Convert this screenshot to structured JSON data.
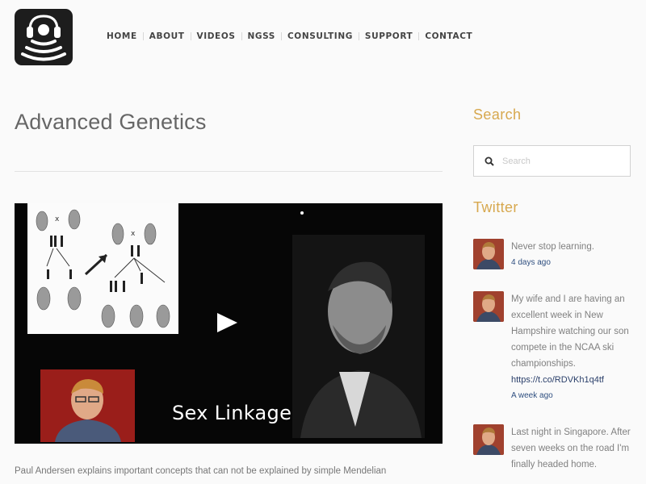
{
  "header": {
    "logo_icon": "headphones-signal-icon",
    "nav": [
      "HOME",
      "ABOUT",
      "VIDEOS",
      "NGSS",
      "CONSULTING",
      "SUPPORT",
      "CONTACT"
    ]
  },
  "main": {
    "title": "Advanced Genetics",
    "video": {
      "caption": "Sex Linkage",
      "play_icon": "play-icon"
    },
    "excerpt": "Paul Andersen explains important concepts that can not be explained by simple Mendelian"
  },
  "sidebar": {
    "search": {
      "title": "Search",
      "placeholder": "Search",
      "icon": "search-icon"
    },
    "twitter": {
      "title": "Twitter",
      "tweets": [
        {
          "text": "Never stop learning.",
          "link": "",
          "time": "4 days ago"
        },
        {
          "text": "My wife and I are having an excellent week in New Hampshire watching our son compete in the NCAA ski championships.",
          "link": "https://t.co/RDVKh1q4tf",
          "time": "A week ago"
        },
        {
          "text": "Last night in Singapore. After seven weeks on the road I'm finally headed home.",
          "link": "",
          "time": ""
        }
      ]
    }
  },
  "colors": {
    "accent": "#d7a84e",
    "link": "#2a3f6a",
    "logo_bg": "#1d1d1d"
  }
}
